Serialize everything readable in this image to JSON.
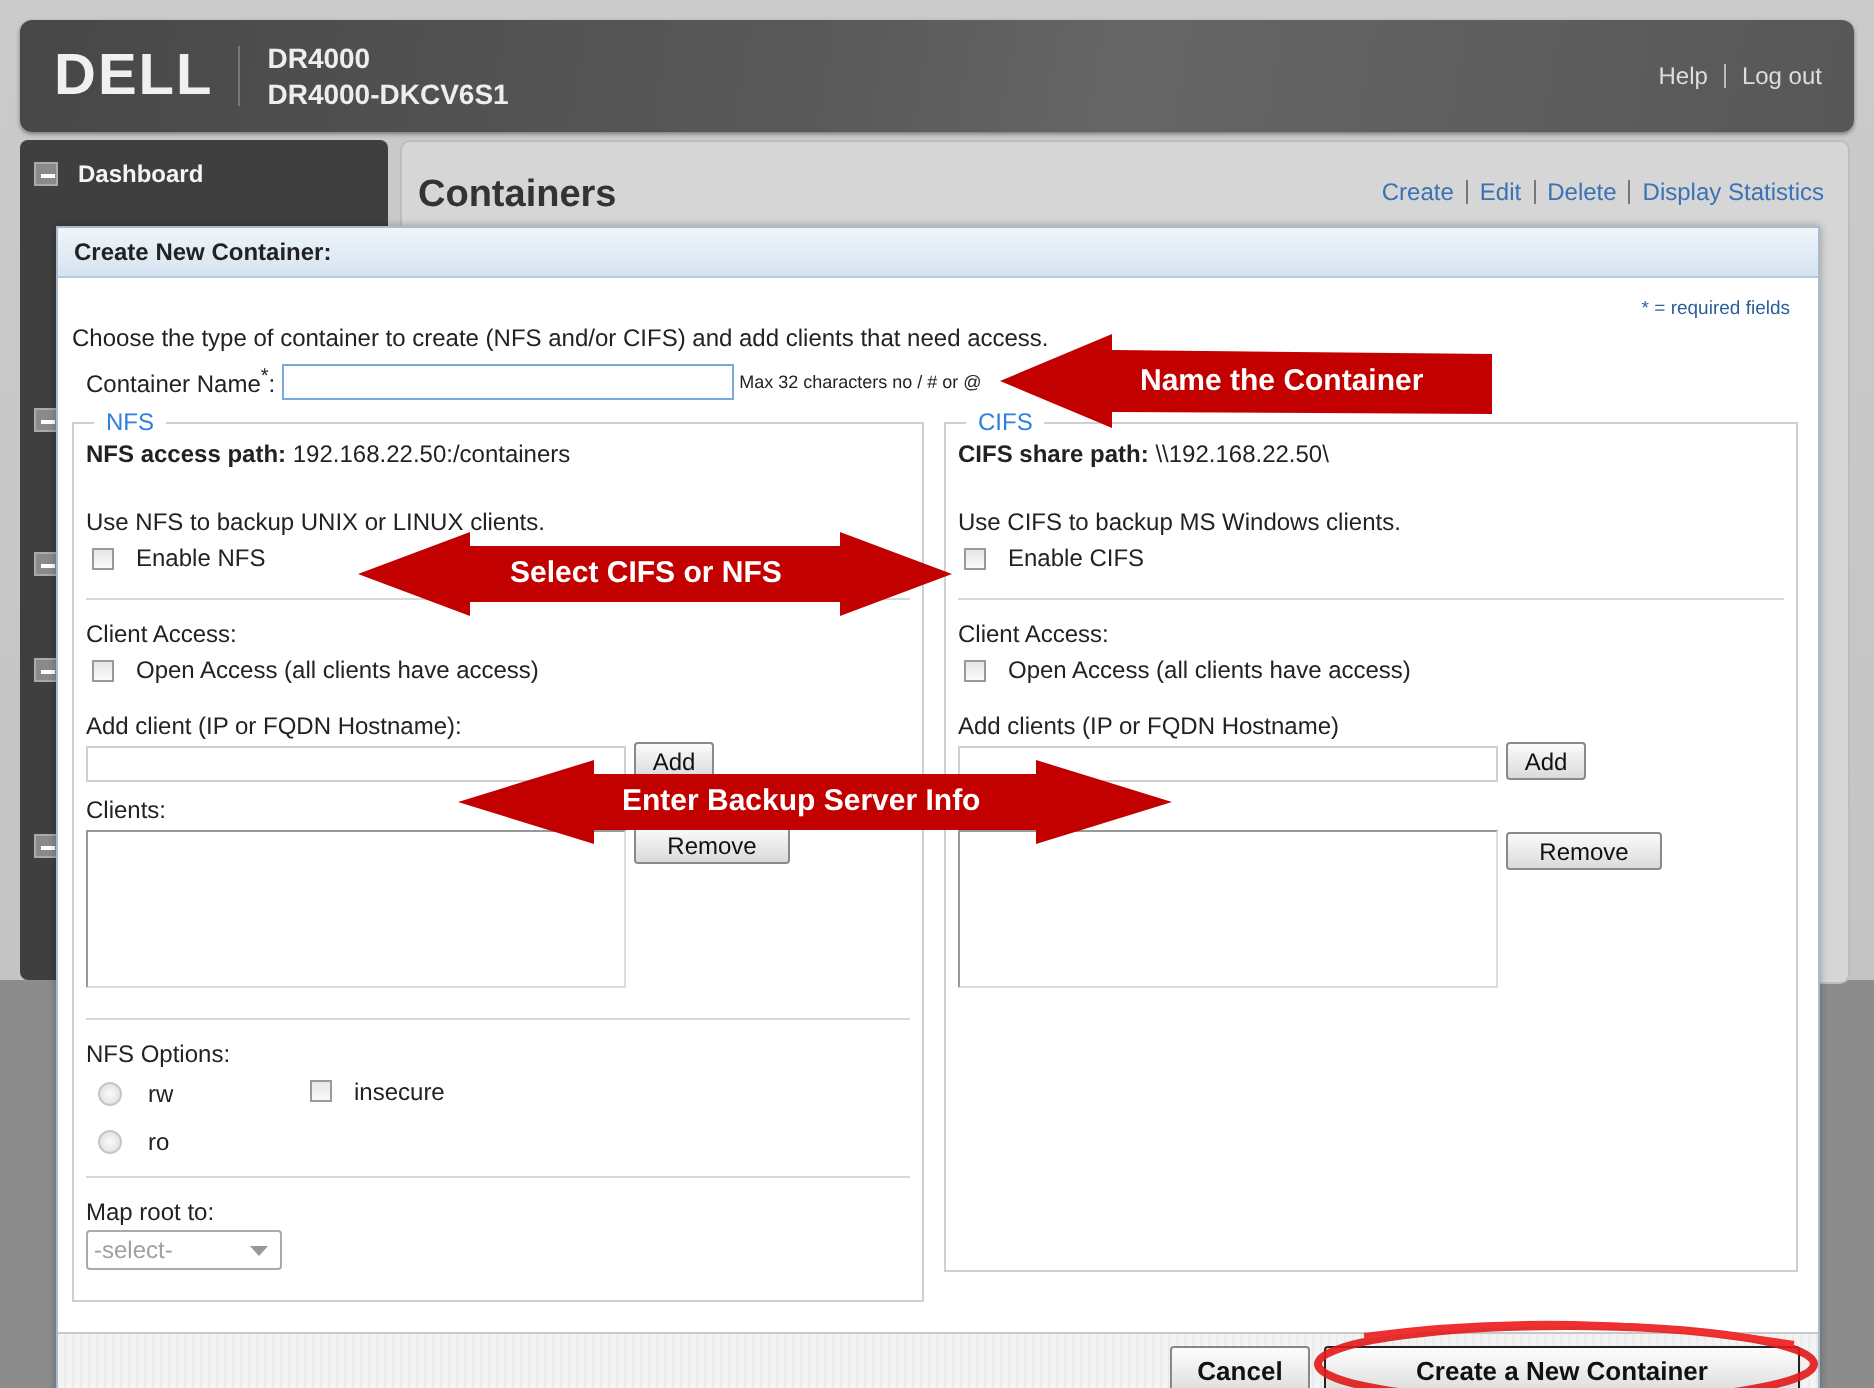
{
  "header": {
    "logo": "DELL",
    "product": "DR4000",
    "hostname": "DR4000-DKCV6S1",
    "links": [
      "Help",
      "Log out"
    ]
  },
  "sidebar": {
    "items": [
      {
        "label": "Dashboard"
      }
    ]
  },
  "page": {
    "title": "Containers",
    "actions": [
      "Create",
      "Edit",
      "Delete",
      "Display Statistics"
    ]
  },
  "dialog": {
    "title": "Create New Container:",
    "required_note": "* = required fields",
    "intro": "Choose the type of container to create (NFS and/or CIFS) and add clients that need access.",
    "name_label": "Container Name$^{*}$:",
    "name_hint": "Max 32 characters no / # or @",
    "sections": [
      {
        "kind": "nfs",
        "legend": "NFS",
        "path": "**NFS access path:** 192.168.22.50:/containers",
        "usage": "Use NFS to backup UNIX or LINUX clients.",
        "enable": {
          "label": "Enable NFS",
          "checked": false
        },
        "client_access_label": "Client Access:",
        "open_access": {
          "label": "Open Access (all clients have access)",
          "checked": false
        },
        "add_label": "Add client (IP or FQDN Hostname):",
        "add_button": "Add",
        "clients_label": "Clients:",
        "remove_button": "Remove",
        "options_label": "NFS Options:",
        "modes": [
          {
            "label": "rw",
            "selected": false
          },
          {
            "label": "ro",
            "selected": false
          }
        ],
        "insecure": {
          "label": "insecure",
          "checked": false
        },
        "map_root_label": "Map root to:",
        "map_root": {
          "value": "-select-",
          "disabled": true
        }
      },
      {
        "kind": "cifs",
        "legend": "CIFS",
        "path": "**CIFS share path:** \\\\192.168.22.50\\",
        "usage": "Use CIFS to backup MS Windows clients.",
        "enable": {
          "label": "Enable CIFS",
          "checked": false
        },
        "client_access_label": "Client Access:",
        "open_access": {
          "label": "Open Access (all clients have access)",
          "checked": false
        },
        "add_label": "Add clients (IP or FQDN Hostname)",
        "add_button": "Add",
        "remove_button": "Remove"
      }
    ],
    "buttons": [
      {
        "label": "Cancel",
        "kind": "secondary"
      },
      {
        "label": "Create a New Container",
        "kind": "primary"
      }
    ]
  },
  "annotations": [
    {
      "kind": "arrow-left",
      "text": "Name the Container"
    },
    {
      "kind": "arrow-both",
      "text": "Select CIFS or NFS"
    },
    {
      "kind": "arrow-both",
      "text": "Enter Backup Server Info"
    },
    {
      "kind": "ring"
    }
  ]
}
